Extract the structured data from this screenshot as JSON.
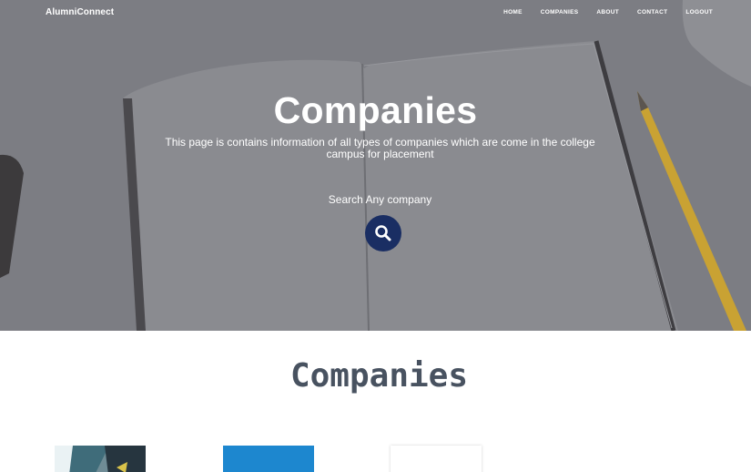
{
  "app": {
    "brand": "AlumniConnect"
  },
  "nav": {
    "items": [
      {
        "label": "HOME"
      },
      {
        "label": "COMPANIES"
      },
      {
        "label": "ABOUT"
      },
      {
        "label": "CONTACT"
      },
      {
        "label": "LOGOUT"
      }
    ]
  },
  "hero": {
    "title": "Companies",
    "description": "This page is contains information of all types of companies which are come in the college campus for placement",
    "search_label": "Search Any company",
    "search_icon": "search-icon",
    "background": "notebook-and-pencil-photo"
  },
  "section": {
    "title": "Companies",
    "cards": [
      {
        "image": "company-image-1"
      },
      {
        "image": "company-image-2"
      },
      {
        "image": "company-image-3"
      }
    ]
  },
  "colors": {
    "hero_overlay": "#7d7e84",
    "search_button": "#1a2e63",
    "section_title": "#485260",
    "text_light": "#ffffff"
  }
}
